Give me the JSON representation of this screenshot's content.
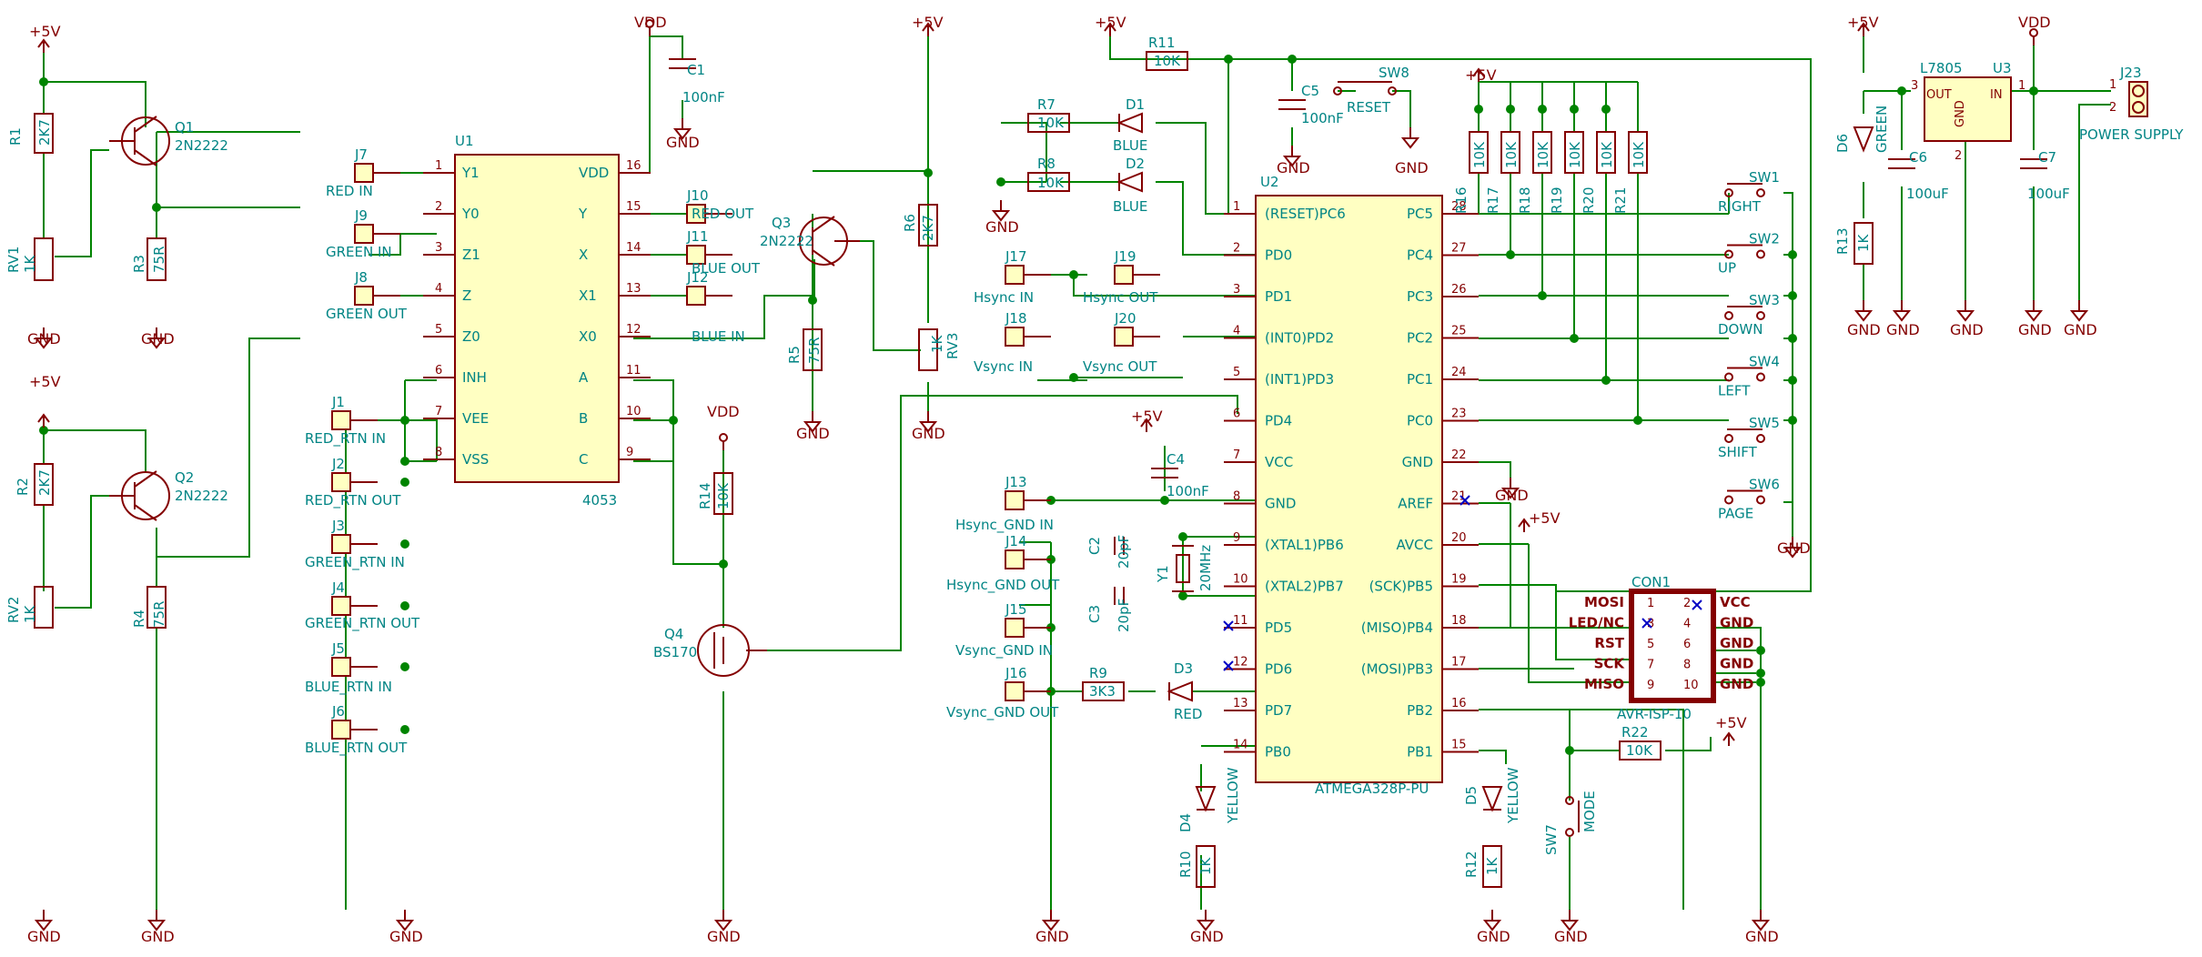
{
  "power": {
    "p5v": "+5V",
    "vdd": "VDD",
    "gnd": "GND"
  },
  "q1": {
    "ref": "Q1",
    "val": "2N2222"
  },
  "q2": {
    "ref": "Q2",
    "val": "2N2222"
  },
  "q3": {
    "ref": "Q3",
    "val": "2N2222"
  },
  "q4": {
    "ref": "Q4",
    "val": "BS170"
  },
  "r1": {
    "ref": "R1",
    "val": "2K7"
  },
  "r2": {
    "ref": "R2",
    "val": "2K7"
  },
  "r3": {
    "ref": "R3",
    "val": "75R"
  },
  "r4": {
    "ref": "R4",
    "val": "75R"
  },
  "r5": {
    "ref": "R5",
    "val": "75R"
  },
  "r6": {
    "ref": "R6",
    "val": "2K7"
  },
  "r7": {
    "ref": "R7",
    "val": "10K"
  },
  "r8": {
    "ref": "R8",
    "val": "10K"
  },
  "r9": {
    "ref": "R9",
    "val": "3K3"
  },
  "r10": {
    "ref": "R10",
    "val": "1K"
  },
  "r11": {
    "ref": "R11",
    "val": "10K"
  },
  "r12": {
    "ref": "R12",
    "val": "1K"
  },
  "r13": {
    "ref": "R13",
    "val": "1K"
  },
  "r14": {
    "ref": "R14",
    "val": "10K"
  },
  "r22": {
    "ref": "R22",
    "val": "10K"
  },
  "rv1": {
    "ref": "RV1",
    "val": "1K"
  },
  "rv2": {
    "ref": "RV2",
    "val": "1K"
  },
  "rv3": {
    "ref": "RV3",
    "val": "1K"
  },
  "c1": {
    "ref": "C1",
    "val": "100nF"
  },
  "c2": {
    "ref": "C2",
    "val": "20pF"
  },
  "c3": {
    "ref": "C3",
    "val": "20pF"
  },
  "c4": {
    "ref": "C4",
    "val": "100nF"
  },
  "c5": {
    "ref": "C5",
    "val": "100nF"
  },
  "c6": {
    "ref": "C6",
    "val": "100uF"
  },
  "c7": {
    "ref": "C7",
    "val": "100uF"
  },
  "y1": {
    "ref": "Y1",
    "val": "20MHz"
  },
  "d1": {
    "ref": "D1",
    "val": "BLUE"
  },
  "d2": {
    "ref": "D2",
    "val": "BLUE"
  },
  "d3": {
    "ref": "D3",
    "val": "RED"
  },
  "d4": {
    "ref": "D4",
    "val": "YELLOW"
  },
  "d5": {
    "ref": "D5",
    "val": "YELLOW"
  },
  "d6": {
    "ref": "D6",
    "val": "GREEN"
  },
  "u1": {
    "ref": "U1",
    "val": "4053",
    "pins_left": [
      [
        "1",
        "Y1"
      ],
      [
        "2",
        "Y0"
      ],
      [
        "3",
        "Z1"
      ],
      [
        "4",
        "Z"
      ],
      [
        "5",
        "Z0"
      ],
      [
        "6",
        "INH"
      ],
      [
        "7",
        "VEE"
      ],
      [
        "8",
        "VSS"
      ]
    ],
    "pins_right": [
      [
        "16",
        "VDD"
      ],
      [
        "15",
        "Y"
      ],
      [
        "14",
        "X"
      ],
      [
        "13",
        "X1"
      ],
      [
        "12",
        "X0"
      ],
      [
        "11",
        "A"
      ],
      [
        "10",
        "B"
      ],
      [
        "9",
        "C"
      ]
    ]
  },
  "u2": {
    "ref": "U2",
    "val": "ATMEGA328P-PU",
    "pins_left": [
      [
        "1",
        "(RESET)PC6"
      ],
      [
        "2",
        "PD0"
      ],
      [
        "3",
        "PD1"
      ],
      [
        "4",
        "(INT0)PD2"
      ],
      [
        "5",
        "(INT1)PD3"
      ],
      [
        "6",
        "PD4"
      ],
      [
        "7",
        "VCC"
      ],
      [
        "8",
        "GND"
      ],
      [
        "9",
        "(XTAL1)PB6"
      ],
      [
        "10",
        "(XTAL2)PB7"
      ],
      [
        "11",
        "PD5"
      ],
      [
        "12",
        "PD6"
      ],
      [
        "13",
        "PD7"
      ],
      [
        "14",
        "PB0"
      ]
    ],
    "pins_right": [
      [
        "28",
        "PC5"
      ],
      [
        "27",
        "PC4"
      ],
      [
        "26",
        "PC3"
      ],
      [
        "25",
        "PC2"
      ],
      [
        "24",
        "PC1"
      ],
      [
        "23",
        "PC0"
      ],
      [
        "22",
        "GND"
      ],
      [
        "21",
        "AREF"
      ],
      [
        "20",
        "AVCC"
      ],
      [
        "19",
        "(SCK)PB5"
      ],
      [
        "18",
        "(MISO)PB4"
      ],
      [
        "17",
        "(MOSI)PB3"
      ],
      [
        "16",
        "PB2"
      ],
      [
        "15",
        "PB1"
      ]
    ]
  },
  "u3": {
    "ref": "U3",
    "val": "L7805",
    "out": "OUT",
    "in": "IN",
    "gnd": "GND",
    "pin_out": "3",
    "pin_in": "1",
    "pin_gnd": "2"
  },
  "jumpers": [
    {
      "ref": "J7",
      "label": "RED IN"
    },
    {
      "ref": "J9",
      "label": "GREEN IN"
    },
    {
      "ref": "J8",
      "label": "GREEN OUT"
    },
    {
      "ref": "J1",
      "label": "RED_RTN IN"
    },
    {
      "ref": "J2",
      "label": "RED_RTN OUT"
    },
    {
      "ref": "J3",
      "label": "GREEN_RTN IN"
    },
    {
      "ref": "J4",
      "label": "GREEN_RTN OUT"
    },
    {
      "ref": "J5",
      "label": "BLUE_RTN IN"
    },
    {
      "ref": "J6",
      "label": "BLUE_RTN OUT"
    },
    {
      "ref": "J10",
      "label": "RED OUT"
    },
    {
      "ref": "J11",
      "label": "BLUE OUT"
    },
    {
      "ref": "J12",
      "label": "BLUE IN"
    },
    {
      "ref": "J17",
      "label": "Hsync IN"
    },
    {
      "ref": "J19",
      "label": "Hsync OUT"
    },
    {
      "ref": "J18",
      "label": "Vsync IN"
    },
    {
      "ref": "J20",
      "label": "Vsync OUT"
    },
    {
      "ref": "J13",
      "label": "Hsync_GND IN"
    },
    {
      "ref": "J14",
      "label": "Hsync_GND OUT"
    },
    {
      "ref": "J15",
      "label": "Vsync_GND IN"
    },
    {
      "ref": "J16",
      "label": "Vsync_GND OUT"
    }
  ],
  "resistors_bank": [
    "R16",
    "R17",
    "R18",
    "R19",
    "R20",
    "R21"
  ],
  "resistors_bank_val": "10K",
  "switches": [
    {
      "ref": "SW1",
      "label": "RIGHT"
    },
    {
      "ref": "SW2",
      "label": "UP"
    },
    {
      "ref": "SW3",
      "label": "DOWN"
    },
    {
      "ref": "SW4",
      "label": "LEFT"
    },
    {
      "ref": "SW5",
      "label": "SHIFT"
    },
    {
      "ref": "SW6",
      "label": "PAGE"
    }
  ],
  "sw7": {
    "ref": "SW7",
    "label": "MODE"
  },
  "sw8": {
    "ref": "SW8",
    "label": "RESET"
  },
  "j23": {
    "ref": "J23",
    "label": "POWER SUPPLY",
    "p1": "1",
    "p2": "2"
  },
  "con1": {
    "ref": "CON1",
    "val": "AVR-ISP-10",
    "left": [
      "MOSI",
      "LED/NC",
      "RST",
      "SCK",
      "MISO"
    ],
    "right": [
      "VCC",
      "GND",
      "GND",
      "GND",
      "GND"
    ],
    "pins": [
      [
        "1",
        "2"
      ],
      [
        "3",
        "4"
      ],
      [
        "5",
        "6"
      ],
      [
        "7",
        "8"
      ],
      [
        "9",
        "10"
      ]
    ]
  }
}
